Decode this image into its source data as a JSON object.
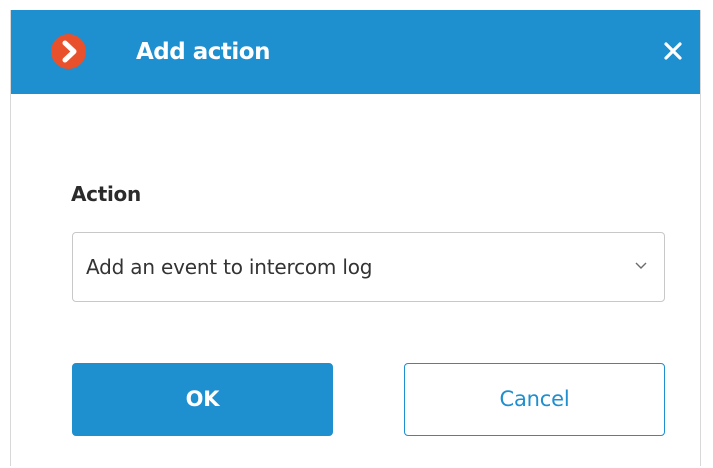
{
  "dialog": {
    "title": "Add action",
    "logo_icon": "chevron-right-logo-icon",
    "close_icon": "close-icon"
  },
  "form": {
    "action_label": "Action",
    "action_selected": "Add an event to intercom log",
    "dropdown_icon": "chevron-down-icon"
  },
  "buttons": {
    "ok_label": "OK",
    "cancel_label": "Cancel"
  },
  "colors": {
    "accent": "#1e8fcf",
    "logo": "#e8512b",
    "text": "#2b2b2b"
  }
}
